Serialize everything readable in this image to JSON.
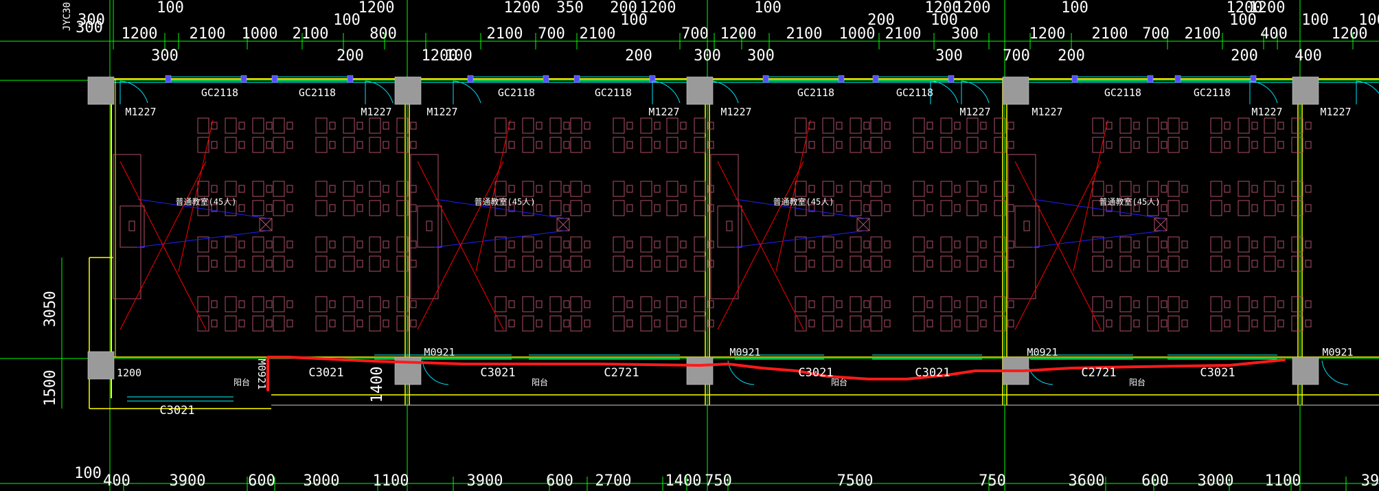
{
  "top_dims": {
    "row0": [
      "100",
      "1200",
      "1200",
      "350",
      "200",
      "1200",
      "100",
      "1200",
      "1200",
      "100",
      "1200",
      "1200"
    ],
    "row1": [
      "300",
      "100",
      "100",
      "200",
      "100",
      "100",
      "100",
      "100"
    ],
    "row2": [
      "1200",
      "2100",
      "1000",
      "2100",
      "800",
      "2100",
      "700",
      "2100",
      "700",
      "1200",
      "2100",
      "1000",
      "2100",
      "300",
      "1200",
      "2100",
      "700",
      "2100",
      "400",
      "1200"
    ],
    "row3": [
      "300",
      "200",
      "1200",
      "100",
      "200",
      "300",
      "300",
      "300",
      "700",
      "200",
      "200",
      "400"
    ]
  },
  "left_labels": {
    "top": "300",
    "axis": "JYC30",
    "dim1": "3050",
    "dim2": "1500",
    "bottom": "100"
  },
  "window_labels": [
    "GC2118",
    "GC2118",
    "GC2118",
    "GC2118",
    "GC2118",
    "GC2118",
    "GC2118",
    "GC2118"
  ],
  "door_labels": [
    "M1227",
    "M1227",
    "M1227",
    "M1227",
    "M1227",
    "M1227",
    "M1227",
    "M1227",
    "M1227"
  ],
  "classroom_label": "普通教室(45人)",
  "balcony_label": "阳台",
  "lower": {
    "m0921": "M0921",
    "m0921_vertical": "M0921",
    "c3021": "C3021",
    "c2721": "C2721",
    "dim_1200": "1200",
    "dim_1400": "1400"
  },
  "bottom_dims": [
    "400",
    "3900",
    "600",
    "3000",
    "1100",
    "3900",
    "600",
    "2700",
    "1400",
    "750",
    "7500",
    "750",
    "3600",
    "600",
    "3000",
    "1100",
    "39"
  ],
  "colors": {
    "background": "#000000",
    "dimension": "#00ff00",
    "wall": "#ffff00",
    "furniture": "#b0506a",
    "window": "#00ffff",
    "door_arc": "#00e5ff",
    "diagonal": "#ff0000",
    "column": "#9a9a9a",
    "markup": "#ff1a1a",
    "label": "#ffffff",
    "blue_guide": "#2020ff"
  }
}
